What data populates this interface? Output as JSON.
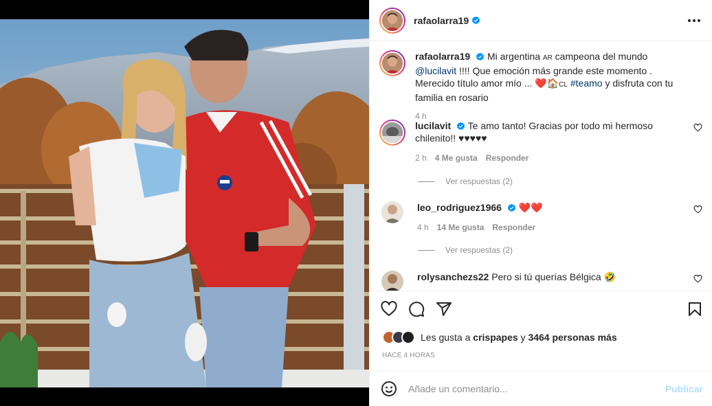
{
  "post": {
    "author": "rafaolarra19",
    "author_verified": true,
    "more_icon": "more-options-icon",
    "caption": {
      "username": "rafaolarra19",
      "part1": "Mi argentina ",
      "flag_ar": "AR",
      "part2": " campeona del mundo ",
      "mention": "@lucilavit",
      "part3": " !!!! Que emoción más grande este momento . Merecido título amor mío ... ",
      "heart": "❤️",
      "family": "🏠",
      "flag_cl": "CL",
      "hashtag": "#teamo",
      "part4": " y disfruta con tu familia en rosario",
      "time": "4 h"
    }
  },
  "comments": [
    {
      "username": "lucilavit",
      "verified": true,
      "text": "Te amo tanto! Gracias por todo mi hermoso chilenito!! ♥♥♥♥♥",
      "time": "2 h",
      "likes": "4 Me gusta",
      "reply": "Responder",
      "view_replies": "Ver respuestas (2)"
    },
    {
      "username": "leo_rodriguez1966",
      "verified": true,
      "text": "❤️❤️",
      "time": "4 h",
      "likes": "14 Me gusta",
      "reply": "Responder",
      "view_replies": "Ver respuestas (2)"
    },
    {
      "username": "rolysanchezs22",
      "verified": false,
      "text": "Pero si tú querías Bélgica 🤣"
    }
  ],
  "actions": {
    "like_icon": "heart-icon",
    "comment_icon": "comment-icon",
    "share_icon": "send-icon",
    "save_icon": "bookmark-icon"
  },
  "likes": {
    "prefix": "Les gusta a ",
    "user": "crispapes",
    "middle": " y ",
    "count": "3464 personas más"
  },
  "timestamp": "Hace 4 horas",
  "add_comment": {
    "placeholder": "Añade un comentario...",
    "publish": "Publicar"
  },
  "colors": {
    "link": "#00376b",
    "verified": "#0095f6",
    "publish_disabled": "#b2dffc",
    "muted": "#8e8e8e"
  }
}
